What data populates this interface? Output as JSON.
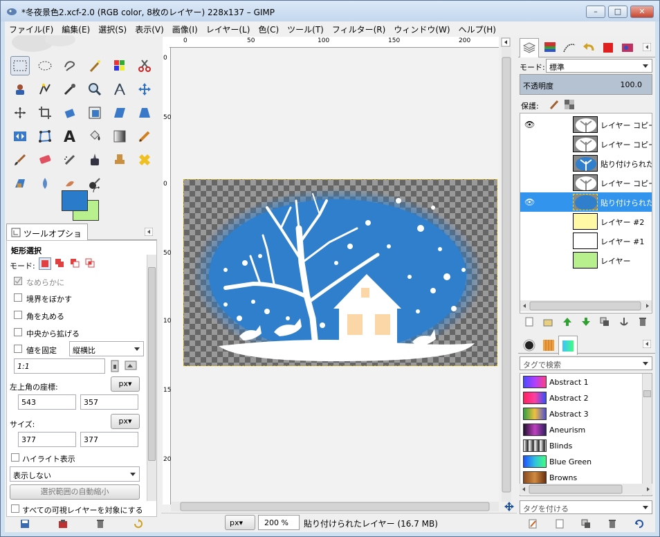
{
  "window": {
    "title": "*冬夜景色2.xcf-2.0 (RGB color, 8枚のレイヤー) 228x137 – GIMP",
    "controls": {
      "minimize": "–",
      "maximize": "□",
      "close": "✕"
    }
  },
  "menu": [
    "ファイル(F)",
    "編集(E)",
    "選択(S)",
    "表示(V)",
    "画像(I)",
    "レイヤー(L)",
    "色(C)",
    "ツール(T)",
    "フィルター(R)",
    "ウィンドウ(W)",
    "ヘルプ(H)"
  ],
  "colors": {
    "foreground": "#2b7bcb",
    "background": "#b8f08e"
  },
  "tool_options": {
    "tab_label": "ツールオプション",
    "tool_name": "矩形選択",
    "mode_label": "モード:",
    "antialias": "なめらかに",
    "feather": "境界をぼかす",
    "rounded": "角を丸める",
    "expand_center": "中央から拡げる",
    "fixed_label": "値を固定",
    "fixed_value": "縦横比",
    "ratio": "1:1",
    "position_label": "左上角の座標:",
    "position_unit": "px▾",
    "pos_x": "543",
    "pos_y": "357",
    "size_label": "サイズ:",
    "size_unit": "px▾",
    "width": "377",
    "height": "377",
    "highlight": "ハイライト表示",
    "guides": "表示しない",
    "autoshrink": "選択範囲の自動縮小",
    "all_visible": "すべての可視レイヤーを対象にする"
  },
  "ruler": {
    "h_labels": [
      "0",
      "50",
      "100",
      "150",
      "200"
    ],
    "v_labels": [
      "0",
      "50",
      "100",
      "150",
      "200",
      "50",
      "0"
    ]
  },
  "status": {
    "unit": "px▾",
    "zoom": "200 %",
    "text": "貼り付けられたレイヤー (16.7 MB)"
  },
  "layers_panel": {
    "mode_label": "モード:",
    "mode_value": "標準",
    "opacity_label": "不透明度",
    "opacity_value": "100.0",
    "lock_label": "保護:",
    "layers": [
      {
        "name": "レイヤー コピー",
        "visible": true,
        "thumb": "tree"
      },
      {
        "name": "レイヤー コピー",
        "visible": false,
        "thumb": "tree"
      },
      {
        "name": "貼り付けられたレ",
        "visible": false,
        "thumb": "blue"
      },
      {
        "name": "レイヤー コピー",
        "visible": false,
        "thumb": "tree"
      },
      {
        "name": "貼り付けられたレ",
        "visible": true,
        "thumb": "bluesel",
        "selected": true
      },
      {
        "name": "レイヤー #2",
        "visible": false,
        "thumb": "#fff9a6"
      },
      {
        "name": "レイヤー #1",
        "visible": false,
        "thumb": "#ffffff"
      },
      {
        "name": "レイヤー",
        "visible": false,
        "thumb": "#b8f08e"
      }
    ]
  },
  "gradients_panel": {
    "search_placeholder": "タグで検索",
    "tag_placeholder": "タグを付ける",
    "items": [
      {
        "name": "Abstract 1",
        "colors": [
          "#4a4aff",
          "#b040ff",
          "#ff4080"
        ]
      },
      {
        "name": "Abstract 2",
        "colors": [
          "#ff2060",
          "#ff40a0",
          "#3050ff"
        ]
      },
      {
        "name": "Abstract 3",
        "colors": [
          "#30a040",
          "#f0c040",
          "#5050d0"
        ]
      },
      {
        "name": "Aneurism",
        "colors": [
          "#201030",
          "#c040c0",
          "#302060"
        ]
      },
      {
        "name": "Blinds",
        "colors": [
          "#ffffff",
          "#000000",
          "#ffffff"
        ]
      },
      {
        "name": "Blue Green",
        "colors": [
          "#2050ff",
          "#30c0e0",
          "#40ff80"
        ]
      },
      {
        "name": "Browns",
        "colors": [
          "#8a4a20",
          "#d08a40",
          "#6a3010"
        ]
      }
    ]
  }
}
